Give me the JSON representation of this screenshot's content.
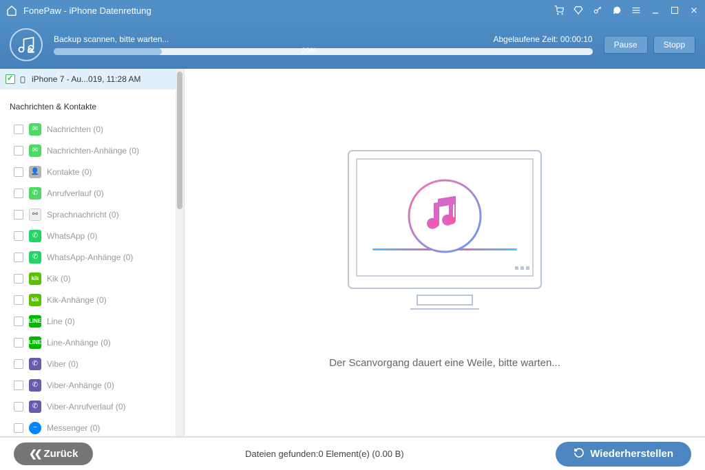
{
  "title": "FonePaw - iPhone Datenrettung",
  "progress": {
    "scan_label": "Backup scannen, bitte warten...",
    "elapsed_prefix": "Abgelaufene Zeit: ",
    "elapsed_time": "00:00:10",
    "percent": "20%",
    "pause_label": "Pause",
    "stop_label": "Stopp"
  },
  "device": {
    "label": "iPhone 7 - Au...019, 11:28 AM"
  },
  "section_messages_contacts": "Nachrichten & Kontakte",
  "items": [
    {
      "label": "Nachrichten (0)",
      "icon": "ico-messages",
      "glyph": "✉"
    },
    {
      "label": "Nachrichten-Anhänge (0)",
      "icon": "ico-messages",
      "glyph": "✉"
    },
    {
      "label": "Kontakte (0)",
      "icon": "ico-contacts",
      "glyph": "👤"
    },
    {
      "label": "Anrufverlauf (0)",
      "icon": "ico-calls",
      "glyph": "✆"
    },
    {
      "label": "Sprachnachricht (0)",
      "icon": "ico-voicemail",
      "glyph": "⚯"
    },
    {
      "label": "WhatsApp (0)",
      "icon": "ico-whatsapp",
      "glyph": "✆"
    },
    {
      "label": "WhatsApp-Anhänge (0)",
      "icon": "ico-whatsapp",
      "glyph": "✆"
    },
    {
      "label": "Kik (0)",
      "icon": "ico-kik",
      "glyph": "kik"
    },
    {
      "label": "Kik-Anhänge (0)",
      "icon": "ico-kik",
      "glyph": "kik"
    },
    {
      "label": "Line (0)",
      "icon": "ico-line",
      "glyph": "LINE"
    },
    {
      "label": "Line-Anhänge (0)",
      "icon": "ico-line",
      "glyph": "LINE"
    },
    {
      "label": "Viber (0)",
      "icon": "ico-viber",
      "glyph": "✆"
    },
    {
      "label": "Viber-Anhänge (0)",
      "icon": "ico-viber",
      "glyph": "✆"
    },
    {
      "label": "Viber-Anrufverlauf (0)",
      "icon": "ico-viber",
      "glyph": "✆"
    },
    {
      "label": "Messenger (0)",
      "icon": "ico-messenger",
      "glyph": "~"
    }
  ],
  "content": {
    "scan_message": "Der Scanvorgang dauert eine Weile, bitte warten..."
  },
  "footer": {
    "back_label": "Zurück",
    "status": "Dateien gefunden:0 Element(e) (0.00 B)",
    "restore_label": "Wiederherstellen"
  }
}
